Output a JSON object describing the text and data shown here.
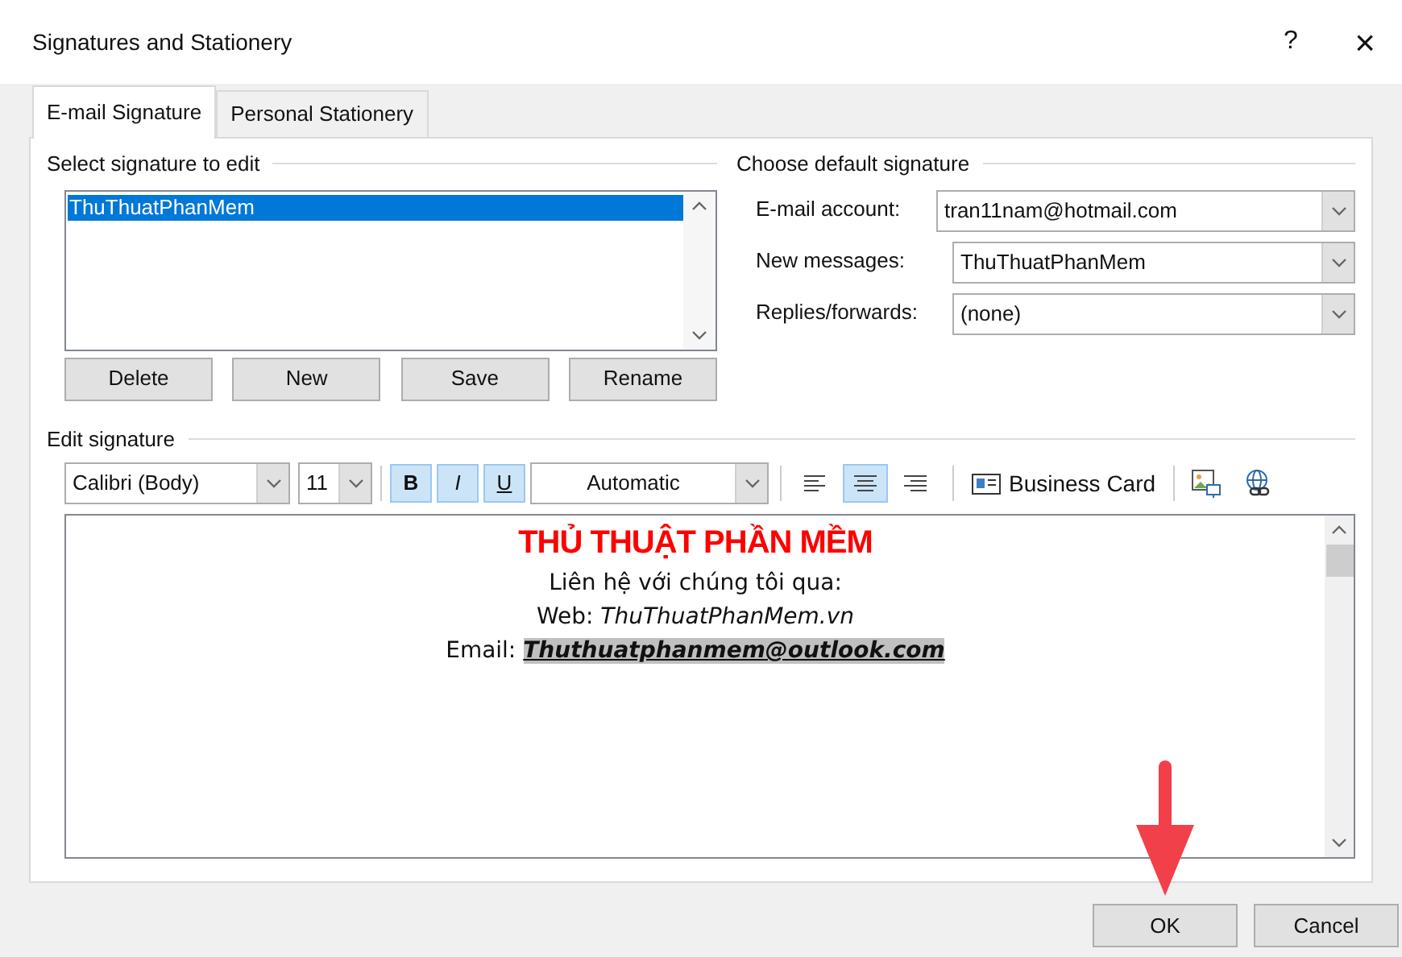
{
  "window": {
    "title": "Signatures and Stationery",
    "help": "?",
    "close": "×"
  },
  "tabs": [
    {
      "label": "E-mail Signature",
      "selected": true
    },
    {
      "label": "Personal Stationery",
      "selected": false
    }
  ],
  "select_signature": {
    "legend": "Select signature to edit",
    "items": [
      {
        "label": "ThuThuatPhanMem",
        "selected": true
      }
    ],
    "buttons": [
      "Delete",
      "New",
      "Save",
      "Rename"
    ]
  },
  "default_signature": {
    "legend": "Choose default signature",
    "fields": [
      {
        "label": "E-mail account:",
        "value": "tran11nam@hotmail.com"
      },
      {
        "label": "New messages:",
        "value": "ThuThuatPhanMem"
      },
      {
        "label": "Replies/forwards:",
        "value": "(none)"
      }
    ]
  },
  "edit_signature": {
    "legend": "Edit signature",
    "font": "Calibri (Body)",
    "size": "11",
    "styles": [
      {
        "label": "B",
        "kind": "bold",
        "on": true
      },
      {
        "label": "I",
        "kind": "italic",
        "on": true
      },
      {
        "label": "U",
        "kind": "underline",
        "on": true
      }
    ],
    "font_color": "Automatic",
    "align": [
      {
        "kind": "left",
        "selected": false
      },
      {
        "kind": "center",
        "selected": true
      },
      {
        "kind": "right",
        "selected": false
      }
    ],
    "business_card": "Business Card",
    "lines": [
      {
        "kind": "heading",
        "text": "THỦ THUẬT PHẦN MỀM"
      },
      {
        "kind": "plain",
        "text": "Liên hệ với chúng tôi qua:"
      },
      {
        "kind": "plain",
        "text": "Web: *ThuThuatPhanMem.vn*"
      },
      {
        "kind": "email",
        "text": "Email: **Thuthuatphanmem@outlook.com**"
      }
    ]
  },
  "buttons": [
    "OK",
    "Cancel"
  ]
}
